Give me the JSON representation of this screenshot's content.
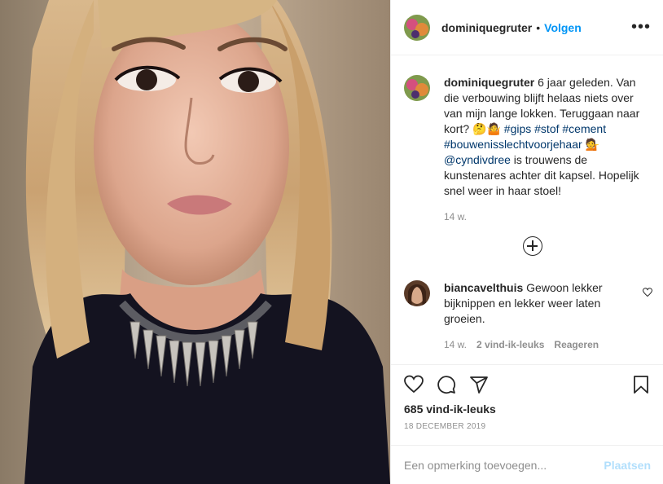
{
  "post": {
    "image_alt": "Selfie of a woman with blond hair wearing a black top and a silver spiked necklace",
    "author": "dominiquegruter",
    "separator": "•",
    "follow_label": "Volgen",
    "more_label": "•••"
  },
  "caption": {
    "username": "dominiquegruter",
    "text_1": " 6 jaar geleden. Van die verbouwing blijft helaas niets over van mijn lange lokken. Teruggaan naar kort? 🤔🤷 ",
    "tag_gips": "#gips",
    "tag_stof": "#stof",
    "tag_cement": "#cement",
    "tag_bouw": "#bouwenisslechtvoorjehaar",
    "emoji": " 💁",
    "mention": "@cyndivdree",
    "text_2": " is trouwens de kunstenares achter dit kapsel. Hopelijk snel weer in haar stoel!",
    "time": "14 w."
  },
  "comments": [
    {
      "username": "biancavelthuis",
      "text": " Gewoon lekker bijknippen en lekker weer laten groeien.",
      "time": "14 w.",
      "likes": "2 vind-ik-leuks",
      "reply_label": "Reageren"
    }
  ],
  "actions": {
    "like_icon": "heart-icon",
    "comment_icon": "comment-icon",
    "share_icon": "share-icon",
    "save_icon": "bookmark-icon"
  },
  "likes": "685 vind-ik-leuks",
  "date": "18 DECEMBER 2019",
  "add_comment": {
    "placeholder": "Een opmerking toevoegen...",
    "post_label": "Plaatsen"
  },
  "colors": {
    "link": "#0095f6",
    "hashtag": "#00376b",
    "muted": "#8e8e8e",
    "post_disabled": "#b2dffc"
  }
}
